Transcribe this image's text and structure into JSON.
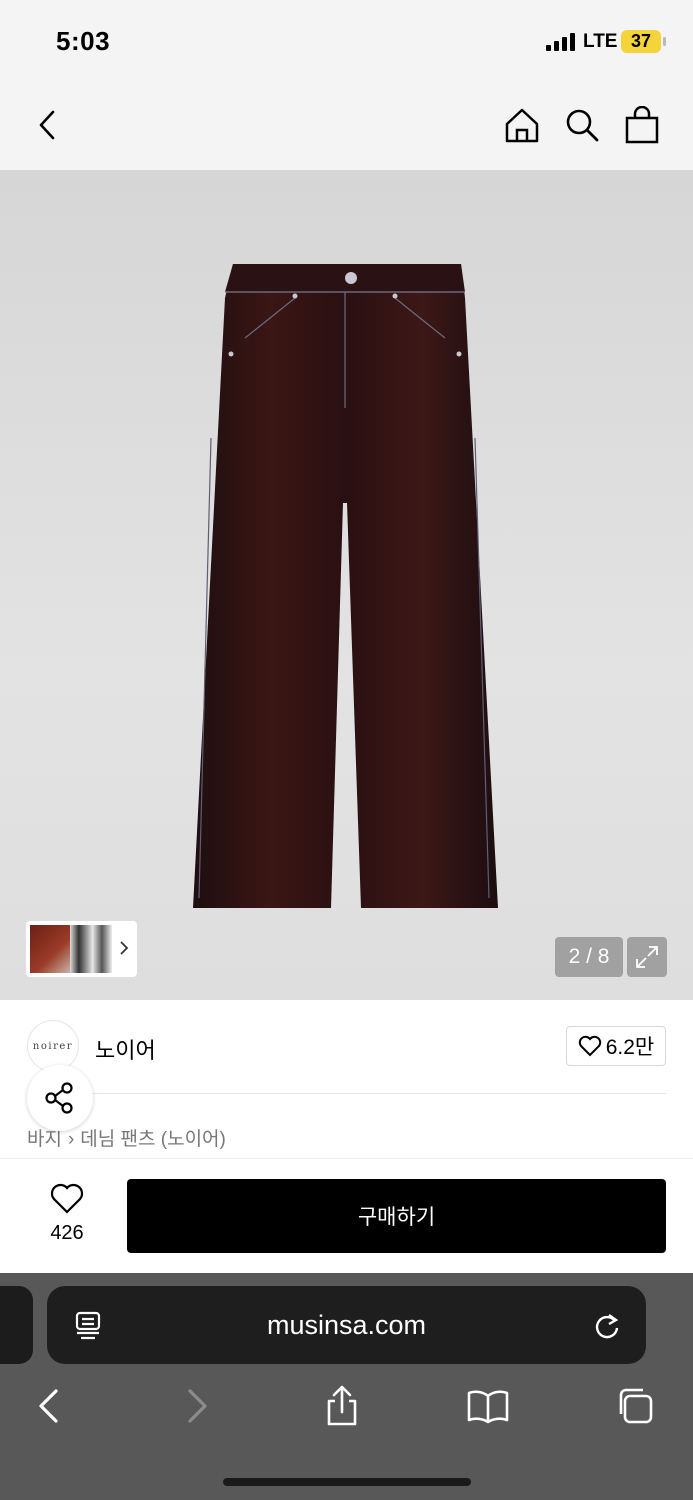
{
  "status_bar": {
    "time": "5:03",
    "network": "LTE",
    "battery": "37"
  },
  "top_nav": {
    "back_icon": "chevron-left-icon",
    "icons": [
      "home-icon",
      "search-icon",
      "shopping-bag-icon"
    ]
  },
  "gallery": {
    "pager": "2 / 8",
    "colors": {
      "product": "#2d1414",
      "stitch": "#8c8ca8"
    }
  },
  "brand": {
    "logo_text": "noirer",
    "name": "노이어",
    "likes": "6.2만"
  },
  "breadcrumb": {
    "items": [
      "바지",
      "데님 팬츠 (노이어)"
    ]
  },
  "action_bar": {
    "wish_count": "426",
    "buy_label": "구매하기"
  },
  "browser": {
    "url": "musinsa.com"
  },
  "colors": {
    "buy_button": "#000000",
    "browser_chrome": "#585858",
    "battery": "#f5d33a"
  }
}
